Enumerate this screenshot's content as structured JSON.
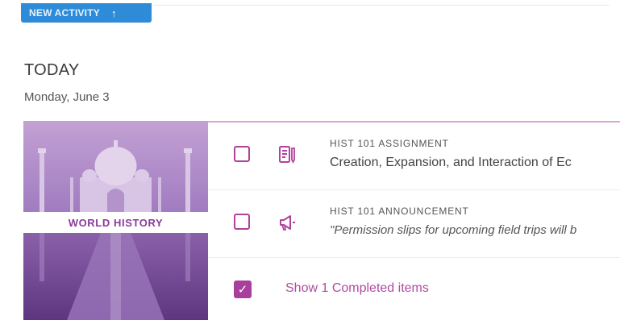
{
  "toolbar": {
    "new_activity_label": "NEW ACTIVITY",
    "new_activity_icon": "plus-icon",
    "button_color": "#2e8bd8"
  },
  "section": {
    "heading": "TODAY",
    "date": "Monday, June 3"
  },
  "course_card": {
    "course_label": "WORLD HISTORY",
    "image": "taj-mahal-purple-tint",
    "accent_color": "#a93f9c"
  },
  "items": [
    {
      "meta": "HIST 101 ASSIGNMENT",
      "title": "Creation, Expansion, and Interaction of Ec",
      "icon": "assignment-icon",
      "checked": false
    },
    {
      "meta": "HIST 101 ANNOUNCEMENT",
      "title": "\"Permission slips for upcoming field trips will b",
      "icon": "announcement-icon",
      "checked": false
    }
  ],
  "completed": {
    "label": "Show 1 Completed items",
    "checked": true
  }
}
